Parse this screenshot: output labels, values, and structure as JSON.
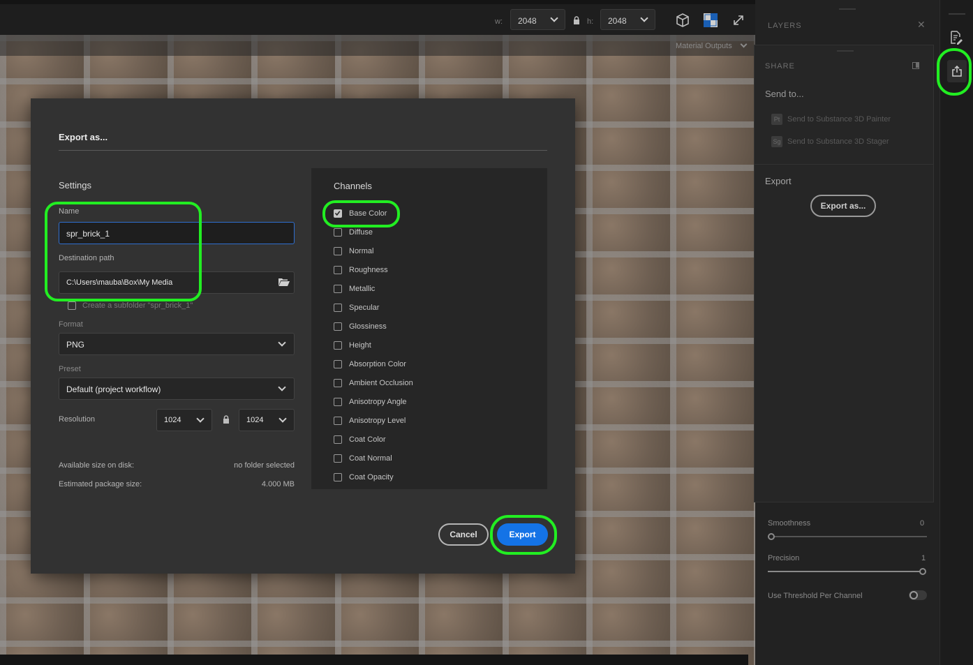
{
  "topbar": {
    "w_label": "w:",
    "w_value": "2048",
    "h_label": "h:",
    "h_value": "2048",
    "icons": [
      "lock-icon",
      "cube-icon",
      "checker-icon",
      "expand-icon"
    ]
  },
  "viewport": {
    "material_outputs": "Material Outputs"
  },
  "right_panel": {
    "layers_title": "LAYERS",
    "share_title": "SHARE",
    "send_to": "Send to...",
    "send_painter": "Send to Substance 3D Painter",
    "send_painter_badge": "Pt",
    "send_stager": "Send to Substance 3D Stager",
    "send_stager_badge": "Sg",
    "export_title": "Export",
    "export_as_button": "Export as...",
    "smoothness_label": "Smoothness",
    "smoothness_value": "0",
    "precision_label": "Precision",
    "precision_value": "1",
    "threshold_label": "Use Threshold Per Channel"
  },
  "dialog": {
    "title": "Export as...",
    "settings_title": "Settings",
    "name_label": "Name",
    "name_value": "spr_brick_1",
    "dest_label": "Destination path",
    "dest_value": "C:\\Users\\mauba\\Box\\My Media",
    "subfolder_label": "Create a subfolder \"spr_brick_1\"",
    "format_label": "Format",
    "format_value": "PNG",
    "preset_label": "Preset",
    "preset_value": "Default (project workflow)",
    "resolution_label": "Resolution",
    "res_w": "1024",
    "res_h": "1024",
    "avail_label": "Available size on disk:",
    "avail_value": "no folder selected",
    "est_label": "Estimated package size:",
    "est_value": "4.000 MB",
    "channels_title": "Channels",
    "channels": [
      {
        "label": "Base Color",
        "checked": true
      },
      {
        "label": "Diffuse",
        "checked": false
      },
      {
        "label": "Normal",
        "checked": false
      },
      {
        "label": "Roughness",
        "checked": false
      },
      {
        "label": "Metallic",
        "checked": false
      },
      {
        "label": "Specular",
        "checked": false
      },
      {
        "label": "Glossiness",
        "checked": false
      },
      {
        "label": "Height",
        "checked": false
      },
      {
        "label": "Absorption Color",
        "checked": false
      },
      {
        "label": "Ambient Occlusion",
        "checked": false
      },
      {
        "label": "Anisotropy Angle",
        "checked": false
      },
      {
        "label": "Anisotropy Level",
        "checked": false
      },
      {
        "label": "Coat Color",
        "checked": false
      },
      {
        "label": "Coat Normal",
        "checked": false
      },
      {
        "label": "Coat Opacity",
        "checked": false
      }
    ],
    "cancel_label": "Cancel",
    "export_label": "Export"
  },
  "colors": {
    "accent": "#1473e6",
    "highlight": "#22ee22",
    "dialog_bg": "#323232"
  }
}
